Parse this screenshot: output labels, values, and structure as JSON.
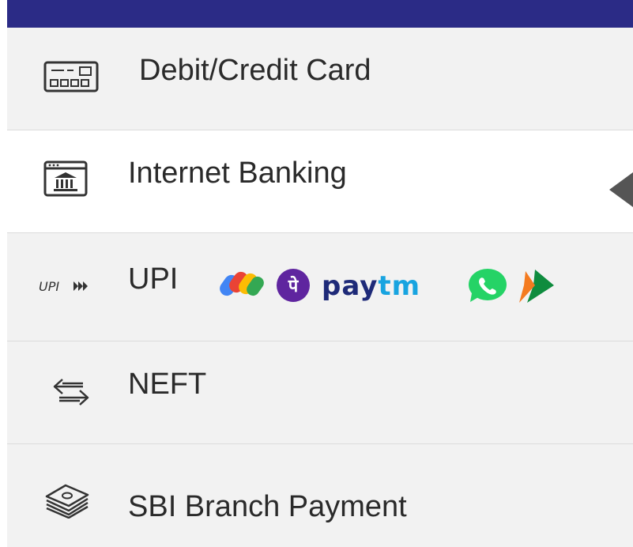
{
  "menu": {
    "items": [
      {
        "label": "Debit/Credit Card",
        "icon": "credit-card-icon",
        "active": false
      },
      {
        "label": "Internet Banking",
        "icon": "bank-building-icon",
        "active": true
      },
      {
        "label": "UPI",
        "icon": "upi-logo-icon",
        "active": false
      },
      {
        "label": "NEFT",
        "icon": "transfer-arrows-icon",
        "active": false
      },
      {
        "label": "SBI Branch Payment",
        "icon": "cash-stack-icon",
        "active": false
      }
    ],
    "upi_apps": {
      "paytm_prefix": "pay",
      "paytm_suffix": "tm",
      "phonepe_glyph": "पे",
      "upi_logo_text": "UPI"
    }
  },
  "colors": {
    "top_bar": "#2b2b86",
    "item_bg": "#f2f2f2",
    "active_bg": "#ffffff",
    "divider": "#dcdcdc",
    "text": "#2a2a2a",
    "pointer": "#555555",
    "phonepe": "#5f259f",
    "paytm_dark": "#1e2a78",
    "paytm_light": "#18a4e0",
    "whatsapp": "#25d366"
  }
}
